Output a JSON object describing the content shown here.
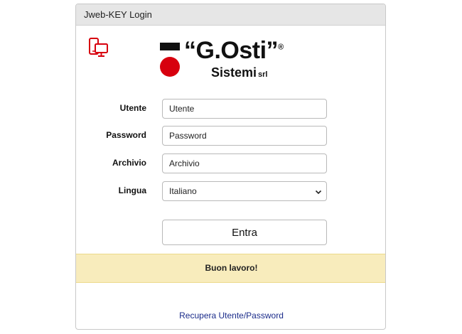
{
  "header": {
    "title": "Jweb-KEY Login"
  },
  "icons": {
    "device": "devices-icon",
    "dropdown": "chevron-down-icon"
  },
  "logo": {
    "name": "“G.Osti”",
    "registered": "®",
    "subtitle": "Sistemi",
    "suffix": "srl",
    "colors": {
      "red": "#d7000e",
      "black": "#111111"
    }
  },
  "form": {
    "user": {
      "label": "Utente",
      "placeholder": "Utente"
    },
    "password": {
      "label": "Password",
      "placeholder": "Password"
    },
    "archive": {
      "label": "Archivio",
      "placeholder": "Archivio"
    },
    "language": {
      "label": "Lingua",
      "selected": "Italiano"
    },
    "submit_label": "Entra"
  },
  "alert": {
    "message": "Buon lavoro!",
    "color": "#f8ecbc"
  },
  "recover_link": "Recupera Utente/Password",
  "colors": {
    "link": "#1a2b8a",
    "icon": "#d7000e"
  }
}
